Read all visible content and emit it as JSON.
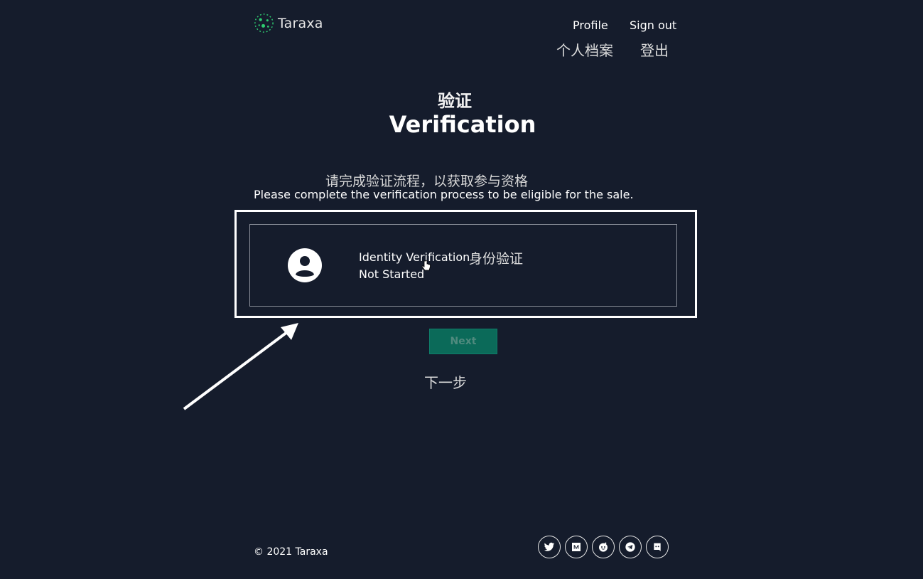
{
  "brand": {
    "name": "Taraxa"
  },
  "nav": {
    "profile": "Profile",
    "profile_zh": "个人档案",
    "sign_out": "Sign out",
    "sign_out_zh": "登出"
  },
  "page": {
    "title_zh": "验证",
    "title": "Verification",
    "description_zh": "请完成验证流程，以获取参与资格",
    "description": "Please complete the verification process to be eligible for the sale."
  },
  "verification_card": {
    "title": "Identity Verification",
    "title_zh": "身份验证",
    "status": "Not Started",
    "icon": "user-avatar-icon"
  },
  "actions": {
    "next_label": "Next",
    "next_label_zh": "下一步"
  },
  "footer": {
    "copyright": "© 2021 Taraxa",
    "socials": [
      "twitter-icon",
      "medium-icon",
      "reddit-icon",
      "telegram-icon",
      "discord-icon"
    ]
  },
  "colors": {
    "background": "#151c2c",
    "accent": "#0b6a59",
    "logo_green": "#2ecc71"
  }
}
